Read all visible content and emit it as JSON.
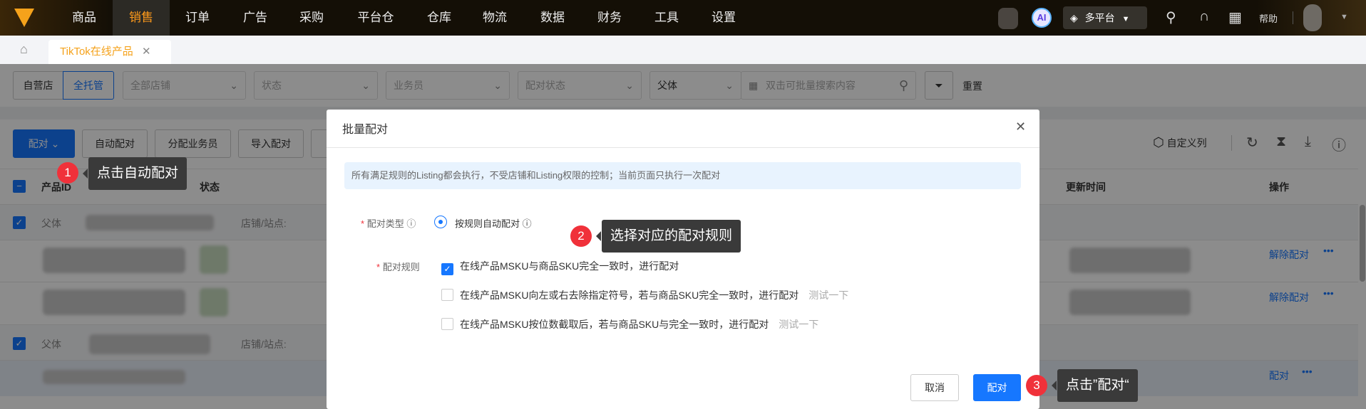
{
  "nav": {
    "items": [
      "商品",
      "销售",
      "订单",
      "广告",
      "采购",
      "平台仓",
      "仓库",
      "物流",
      "数据",
      "财务",
      "工具",
      "设置"
    ],
    "active": "销售",
    "ai_label": "AI",
    "platform_label": "多平台",
    "help_label": "帮助"
  },
  "tabs": {
    "home_icon": "home-icon",
    "items": [
      {
        "label": "TikTok在线产品"
      }
    ]
  },
  "filters": {
    "shop_type": [
      "自营店",
      "全托管"
    ],
    "shop_type_active": "全托管",
    "all_shops": "全部店铺",
    "status": "状态",
    "salesperson": "业务员",
    "match_status": "配对状态",
    "search_field": "父体",
    "search_placeholder": "双击可批量搜索内容",
    "reset": "重置"
  },
  "toolbar": {
    "match": "配对",
    "auto_match": "自动配对",
    "assign": "分配业务员",
    "import_match": "导入配对",
    "custom_columns": "自定义列"
  },
  "table": {
    "columns": [
      "产品ID",
      "状态",
      "更新时间",
      "操作"
    ],
    "parent_label": "父体",
    "shop_label": "店铺/站点:",
    "unmatch": "解除配对",
    "match": "配对",
    "more": "•••"
  },
  "modal": {
    "title": "批量配对",
    "info": "所有满足规则的Listing都会执行，不受店铺和Listing权限的控制；当前页面只执行一次配对",
    "type_label": "配对类型",
    "type_option": "按规则自动配对",
    "rule_label": "配对规则",
    "rules": [
      {
        "text": "在线产品MSKU与商品SKU完全一致时，进行配对",
        "checked": true,
        "test": ""
      },
      {
        "text": "在线产品MSKU向左或右去除指定符号，若与商品SKU完全一致时，进行配对",
        "checked": false,
        "test": "测试一下"
      },
      {
        "text": "在线产品MSKU按位数截取后，若与商品SKU与完全一致时，进行配对",
        "checked": false,
        "test": "测试一下"
      }
    ],
    "cancel": "取消",
    "confirm": "配对"
  },
  "tips": [
    {
      "num": "1",
      "text": "点击自动配对"
    },
    {
      "num": "2",
      "text": "选择对应的配对规则"
    },
    {
      "num": "3",
      "text": "点击”配对“"
    }
  ],
  "colors": {
    "accent": "#1677ff",
    "nav_active": "#ff9a1a",
    "badge": "#f0313a"
  }
}
